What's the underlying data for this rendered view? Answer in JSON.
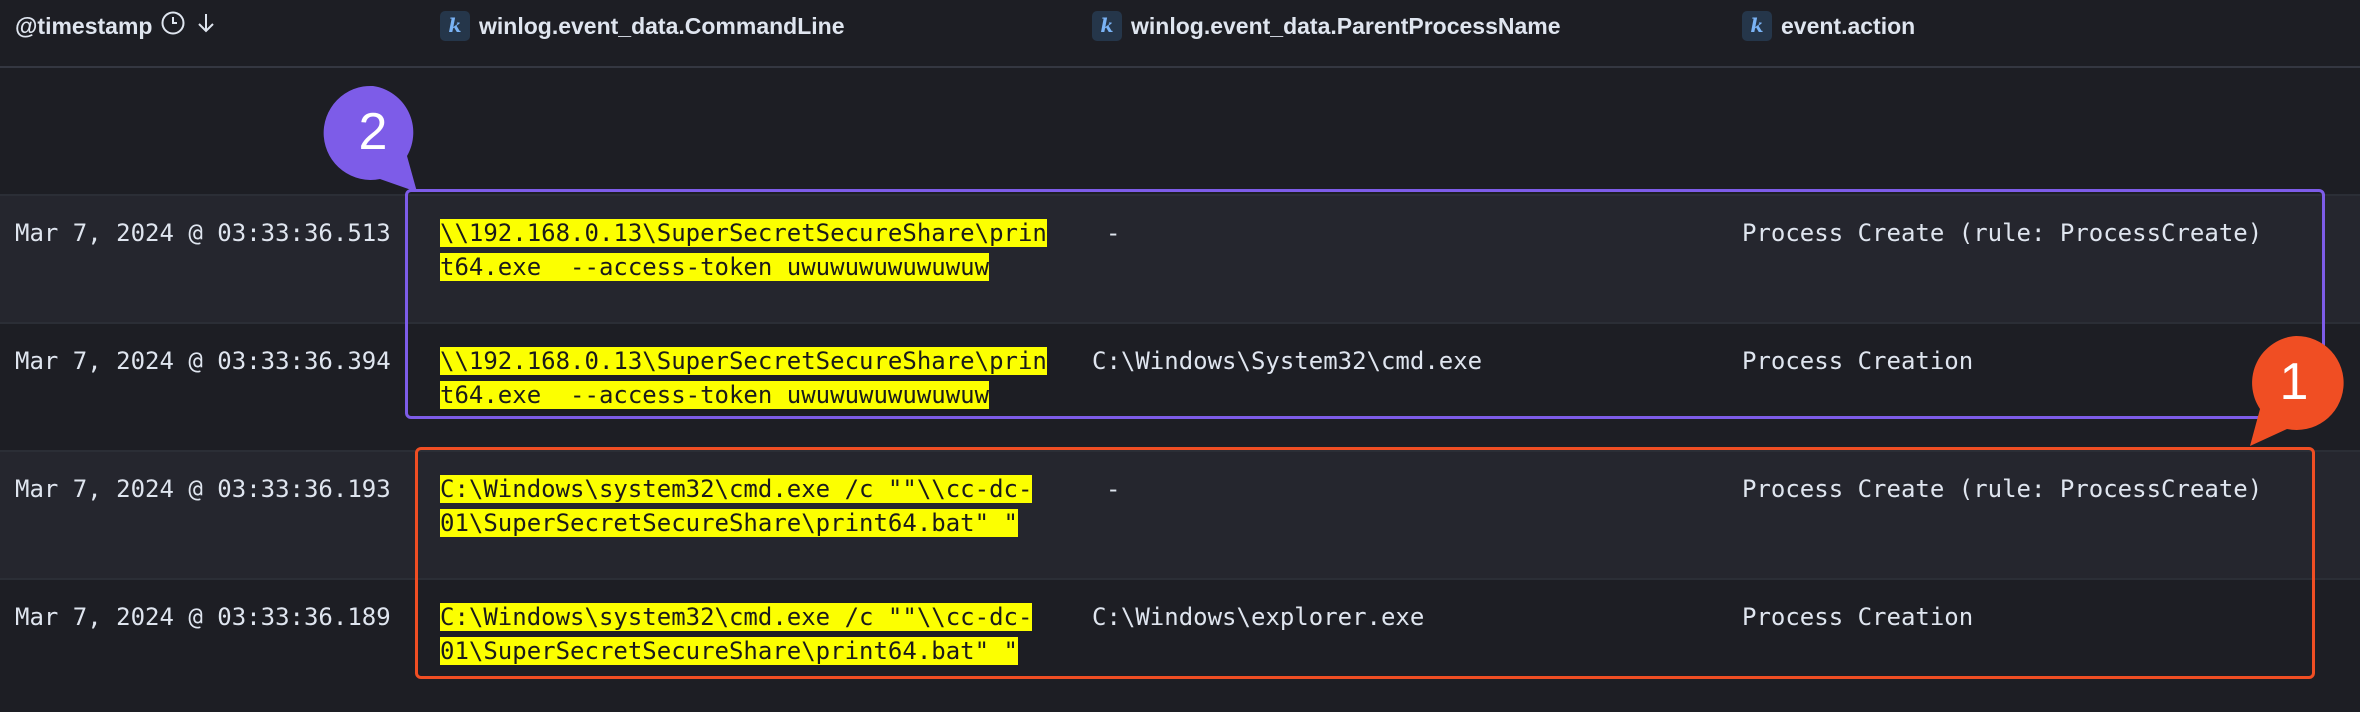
{
  "header": {
    "timestamp_label": "@timestamp",
    "commandline_label": "winlog.event_data.CommandLine",
    "parent_label": "winlog.event_data.ParentProcessName",
    "action_label": "event.action",
    "field_type_badge": "k",
    "icons": [
      "clock-icon",
      "sort-descending-icon"
    ]
  },
  "rows": [
    {
      "timestamp": "Mar 7, 2024 @ 03:33:36.513",
      "cmd_line1": "\\\\192.168.0.13\\SuperSecretSecureShare\\prin",
      "cmd_line2": "t64.exe  --access-token uwuwuwuwuwuwuw",
      "parent": "-",
      "action": "Process Create (rule: ProcessCreate)"
    },
    {
      "timestamp": "Mar 7, 2024 @ 03:33:36.394",
      "cmd_line1": "\\\\192.168.0.13\\SuperSecretSecureShare\\prin",
      "cmd_line2": "t64.exe  --access-token uwuwuwuwuwuwuw",
      "parent": "C:\\Windows\\System32\\cmd.exe",
      "action": "Process Creation"
    },
    {
      "timestamp": "Mar 7, 2024 @ 03:33:36.193",
      "cmd_line1": "C:\\Windows\\system32\\cmd.exe /c \"\"\\\\cc-dc-",
      "cmd_line2": "01\\SuperSecretSecureShare\\print64.bat\" \"",
      "parent": "-",
      "action": "Process Create (rule: ProcessCreate)"
    },
    {
      "timestamp": "Mar 7, 2024 @ 03:33:36.189",
      "cmd_line1": "C:\\Windows\\system32\\cmd.exe /c \"\"\\\\cc-dc-",
      "cmd_line2": "01\\SuperSecretSecureShare\\print64.bat\" \"",
      "parent": "C:\\Windows\\explorer.exe",
      "action": "Process Creation"
    }
  ],
  "annotations": {
    "marker_purple": "2",
    "marker_orange": "1",
    "purple_color": "#7d5ce8",
    "orange_color": "#f04e23",
    "highlight_color": "#fcff00"
  }
}
